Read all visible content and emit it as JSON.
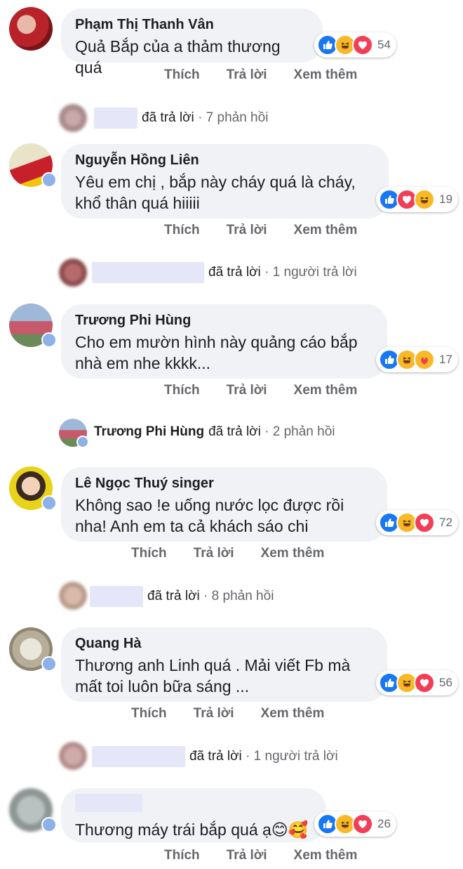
{
  "comments": [
    {
      "name": "Phạm Thị Thanh Vân",
      "text": [
        "Quả Bắp của a thảm thương quá"
      ],
      "reactions": [
        "like",
        "haha",
        "love"
      ],
      "count": "54"
    },
    {
      "name": "Nguyễn Hồng Liên",
      "text": [
        "Yêu em chị , bắp này cháy quá là cháy,",
        "khổ thân quá hiiiii"
      ],
      "reactions": [
        "like",
        "love",
        "haha"
      ],
      "count": "19"
    },
    {
      "name": "Trương Phi Hùng",
      "text": [
        "Cho em mườn hình này quảng cáo bắp",
        "nhà em nhe kkkk..."
      ],
      "reactions": [
        "like",
        "haha",
        "care"
      ],
      "count": "17"
    },
    {
      "name": "Lê Ngọc Thuý singer",
      "text": [
        "Không sao !e uống nước lọc được rồi",
        "nha! Anh em ta cả khách sáo chi"
      ],
      "reactions": [
        "like",
        "haha",
        "love"
      ],
      "count": "72"
    },
    {
      "name": "Quang Hà",
      "text": [
        "Thương anh Linh quá . Mải viết Fb mà",
        "mất toi luôn bữa sáng ..."
      ],
      "reactions": [
        "like",
        "haha",
        "love"
      ],
      "count": "56"
    },
    {
      "name": "",
      "text": [
        "Thương máy trái bắp quá ạ😊🥰"
      ],
      "reactions": [
        "like",
        "haha",
        "love"
      ],
      "count": "26"
    }
  ],
  "actions": {
    "like": "Thích",
    "reply": "Trả lời",
    "more": "Xem thêm"
  },
  "replies": [
    {
      "name": "",
      "verb": "đã trả lời",
      "meta": "· 7 phản hồi"
    },
    {
      "name": "",
      "verb": "đã trả lời",
      "meta": "· 1 người trả lời"
    },
    {
      "name": "Trương Phi Hùng",
      "verb": "đã trả lời",
      "meta": "· 2 phản hồi"
    },
    {
      "name": "",
      "verb": "đã trả lời",
      "meta": "· 8 phản hồi"
    },
    {
      "name": "",
      "verb": "đã trả lời",
      "meta": "· 1 người trả lời"
    }
  ]
}
